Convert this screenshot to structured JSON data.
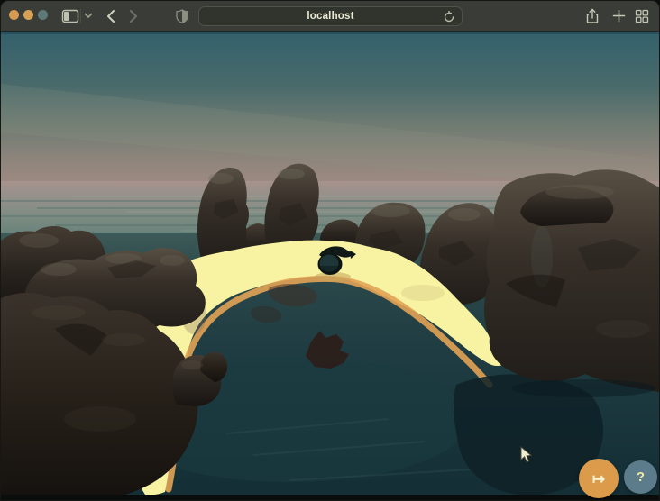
{
  "browser": {
    "traffic_lights": [
      {
        "name": "close",
        "color": "#d5994f"
      },
      {
        "name": "minimize",
        "color": "#d7a055"
      },
      {
        "name": "zoom",
        "color": "#5e7a78"
      }
    ],
    "toolbar_icons": [
      "sidebar-icon",
      "chevron-down-icon",
      "back-icon",
      "forward-icon",
      "privacy-shield-icon",
      "reload-icon",
      "share-icon",
      "new-tab-icon",
      "tab-overview-icon"
    ],
    "url_bar": {
      "text": "localhost"
    }
  },
  "scene": {
    "description": "3D rendered island cove: dark rock formations around a bright sand beach and teal lagoon at dusk",
    "objects": [
      "sky gradient",
      "distant ocean",
      "rock formations",
      "sand beach",
      "wet sand shoreline",
      "lagoon water",
      "rowboat on shore",
      "dark rock in water",
      "submerged rock shadow"
    ],
    "colors": {
      "sky_top": "#33616c",
      "horizon": "#a8928c",
      "distant_sea": "#7d8c82",
      "sand": "#f7f3a3",
      "wet_sand": "#e2a355",
      "lagoon_water": "#1d3a40",
      "rock": "#362f28"
    }
  },
  "overlay": {
    "enter_button": {
      "icon": "↦",
      "color": "#dc9b4b"
    },
    "help_button": {
      "label": "?",
      "color": "#5c7b8b"
    }
  }
}
